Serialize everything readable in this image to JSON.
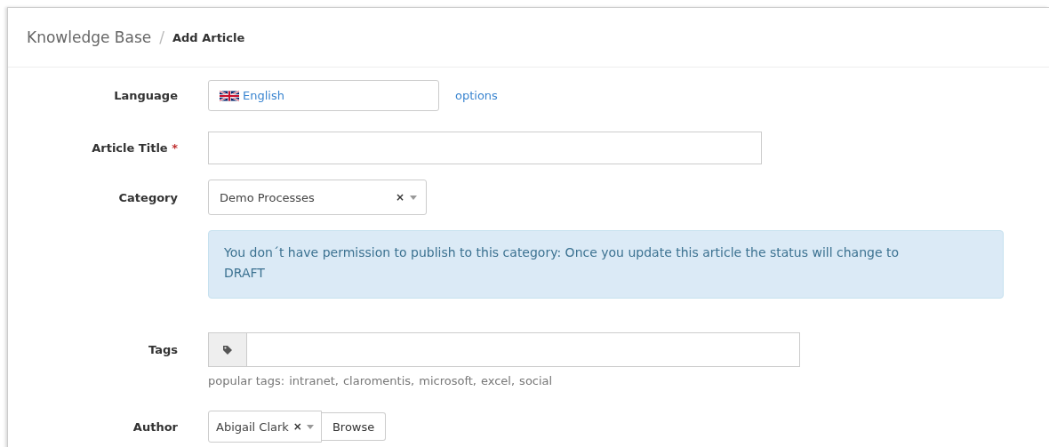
{
  "breadcrumb": {
    "parent": "Knowledge Base",
    "separator": "/",
    "current": "Add Article"
  },
  "form": {
    "language": {
      "label": "Language",
      "value": "English",
      "link": "options"
    },
    "title": {
      "label": "Article Title",
      "required_mark": "*"
    },
    "category": {
      "label": "Category",
      "value": "Demo Processes",
      "clear": "×"
    },
    "alert": {
      "text": "You don´t have permission to publish to this category: Once you update this article the status will change to DRAFT"
    },
    "tags": {
      "label": "Tags",
      "hint": "popular tags:",
      "popular": [
        "intranet,",
        "claromentis,",
        "microsoft,",
        "excel,",
        "social"
      ]
    },
    "author": {
      "label": "Author",
      "value": "Abigail Clark",
      "clear": "×",
      "button": "Browse"
    }
  }
}
